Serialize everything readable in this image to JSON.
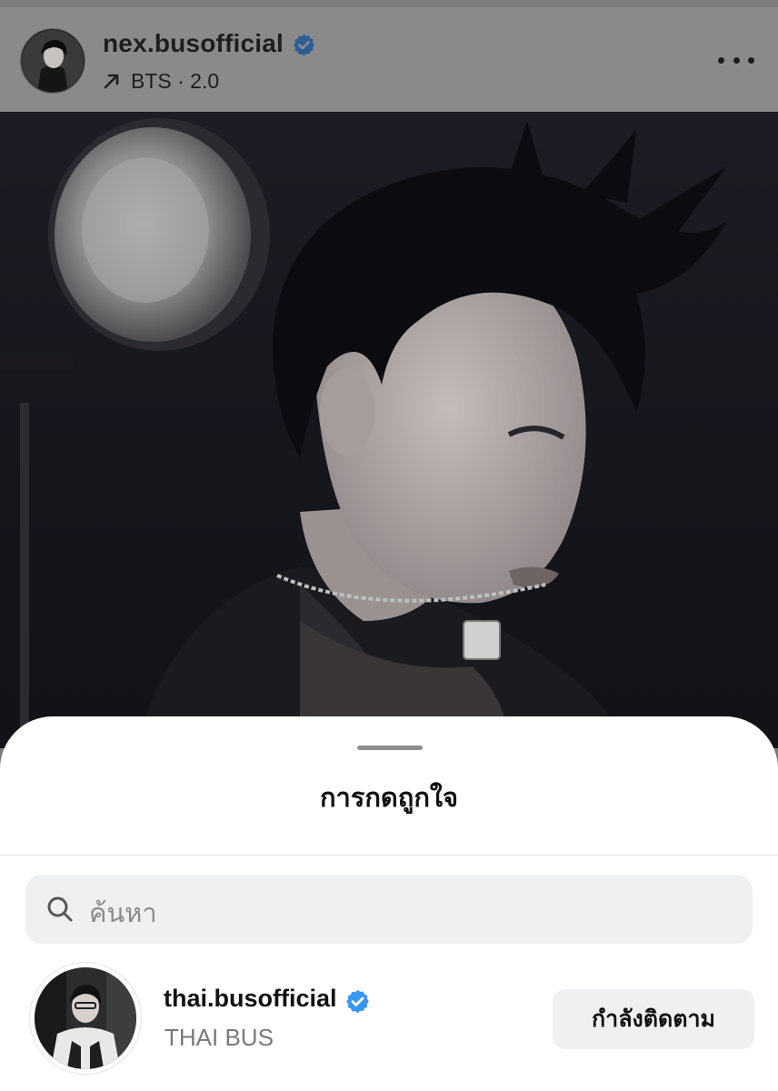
{
  "post": {
    "username": "nex.busofficial",
    "verified": true,
    "music_label": "BTS · 2.0",
    "more_icon": "more-horizontal-icon",
    "music_icon": "arrow-up-right-icon"
  },
  "likes_sheet": {
    "title": "การกดถูกใจ",
    "search": {
      "placeholder": "ค้นหา",
      "icon": "search-icon"
    },
    "users": [
      {
        "username": "thai.busofficial",
        "full_name": "THAI BUS",
        "verified": true,
        "follow_button_label": "กำลังติดตาม"
      }
    ]
  },
  "colors": {
    "verified_blue": "#3897f0",
    "dim_overlay": "#808080",
    "sheet_background": "#ffffff",
    "button_background": "#eff0f2"
  }
}
